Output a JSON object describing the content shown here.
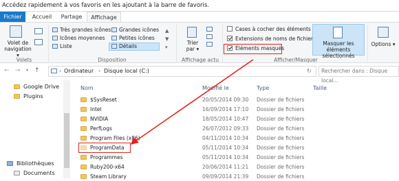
{
  "favorites_bar": {
    "text": "Accédez rapidement à vos favoris en les ajoutant à la barre de favoris."
  },
  "ribbon_tabs": [
    "Fichier",
    "Accueil",
    "Partage",
    "Affichage"
  ],
  "ribbon": {
    "volets": {
      "nav_label": "Volet de navigation ▾",
      "group_label": "Volets"
    },
    "disposition": {
      "items": [
        "Très grandes icônes",
        "Grandes icônes",
        "Icônes moyennes",
        "Petites icônes",
        "Liste",
        "Détails"
      ],
      "group_label": "Disposition"
    },
    "affichage_actuel": {
      "sort_label": "Trier par ▾",
      "group_label": "Affichage actu"
    },
    "afficher_masquer": {
      "checkboxes": [
        {
          "label": "Cases à cocher des éléments",
          "checked": false
        },
        {
          "label": "Extensions de noms de fichiers",
          "checked": true
        },
        {
          "label": "Éléments masqués",
          "checked": true
        }
      ],
      "hide_selected_label": "Masquer les éléments sélectionnés",
      "group_label": "Afficher/Masquer"
    },
    "options_label": "Options ▾"
  },
  "address": {
    "path": [
      "Ordinateur",
      "Disque local (C:)"
    ],
    "search_placeholder": "Rechercher dans : Disque local..."
  },
  "nav_pane": {
    "items": [
      "Google Drive",
      "Plugins",
      "Bibliothèques",
      "Documents"
    ]
  },
  "file_list": {
    "columns": [
      "Nom",
      "Modifié le",
      "Type",
      "Taille"
    ],
    "rows": [
      {
        "name": "$SysReset",
        "modified": "20/05/2014 09:30",
        "type": "Dossier de fichiers"
      },
      {
        "name": "Intel",
        "modified": "16/09/2014 17:10",
        "type": "Dossier de fichiers"
      },
      {
        "name": "NVIDIA",
        "modified": "18/05/2014 10:47",
        "type": "Dossier de fichiers"
      },
      {
        "name": "PerfLogs",
        "modified": "26/07/2012 09:33",
        "type": "Dossier de fichiers"
      },
      {
        "name": "Program Files (x86)",
        "modified": "04/11/2014 10:34",
        "type": "Dossier de fichiers"
      },
      {
        "name": "ProgramData",
        "modified": "05/11/2014 10:34",
        "type": "Dossier de fichiers"
      },
      {
        "name": "Programmes",
        "modified": "05/11/2014 10:34",
        "type": "Dossier de fichiers"
      },
      {
        "name": "Ruby200-x64",
        "modified": "20/06/2014 11:21",
        "type": "Dossier de fichiers"
      },
      {
        "name": "Steam Library",
        "modified": "09/09/2014 21:39",
        "type": "Dossier de fichiers"
      }
    ]
  },
  "colors": {
    "file_tab": "#1979ca",
    "highlight": "#e2231a",
    "selected_view": "#cce4f7"
  }
}
